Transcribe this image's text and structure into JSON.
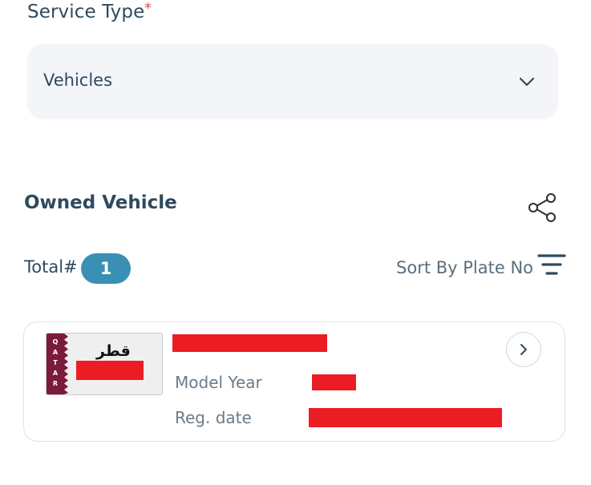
{
  "service_type": {
    "label": "Service Type",
    "required_mark": "*",
    "selected_value": "Vehicles",
    "icon": "chevron-down-icon"
  },
  "section": {
    "title": "Owned Vehicle",
    "share_icon": "share-icon"
  },
  "summary": {
    "total_label": "Total#",
    "total_count": "1",
    "sort_label": "Sort By Plate No",
    "sort_icon": "sort-lines-icon"
  },
  "vehicle_card": {
    "plate": {
      "country_letters": [
        "Q",
        "A",
        "T",
        "A",
        "R"
      ],
      "arabic_text": "قطر"
    },
    "model_year_label": "Model Year",
    "reg_date_label": "Reg. date",
    "open_icon": "chevron-right-icon"
  },
  "colors": {
    "primary_text": "#2f4a5e",
    "badge": "#3a8fb5",
    "required": "#e5484d",
    "plate_maroon": "#7a1a3c",
    "redaction": "#ec1c24"
  }
}
